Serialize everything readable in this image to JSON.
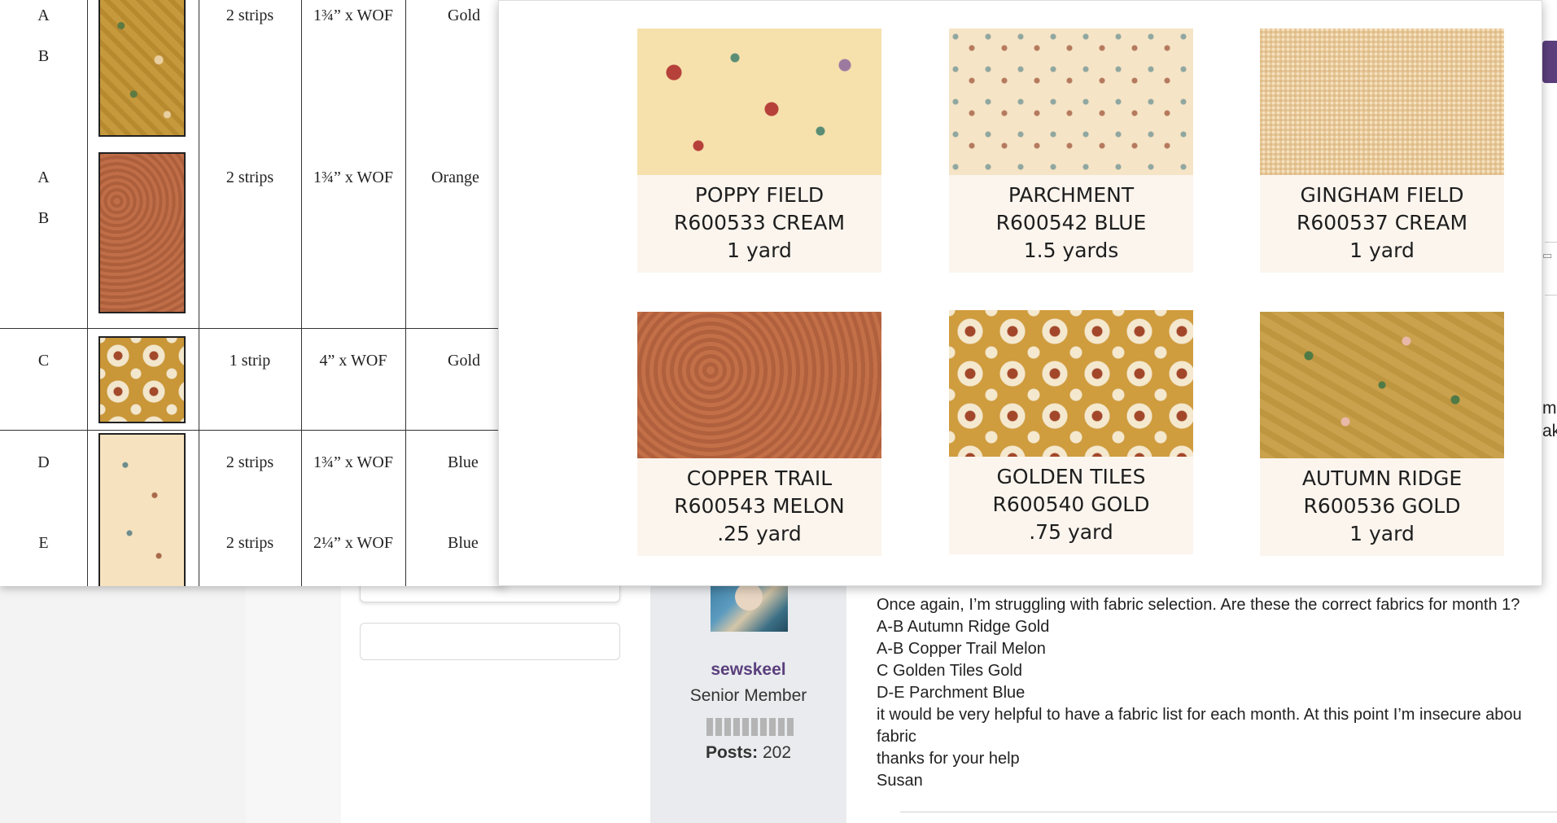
{
  "fabric_table": {
    "rows": [
      {
        "letters": [
          "A",
          "B"
        ],
        "swatch": "gold-floral",
        "qty": "2 strips",
        "size": "1¾” x WOF",
        "color": "Gold"
      },
      {
        "letters": [
          "A",
          "B"
        ],
        "swatch": "copper",
        "qty": "2 strips",
        "size": "1¾” x WOF",
        "color": "Orange"
      },
      {
        "letters": [
          "C"
        ],
        "swatch": "golden-tiles",
        "qty": "1 strip",
        "size": "4” x WOF",
        "color": "Gold"
      },
      {
        "letters": [
          "D",
          "E"
        ],
        "swatch": "parchment",
        "qty": [
          "2 strips",
          "2 strips"
        ],
        "size": [
          "1¾” x WOF",
          "2¼” x WOF"
        ],
        "color": [
          "Blue",
          "Blue"
        ]
      }
    ]
  },
  "fabric_list": [
    {
      "name": "POPPY FIELD",
      "sku": "R600533  CREAM",
      "amount": "1 yard"
    },
    {
      "name": "PARCHMENT",
      "sku": "R600542  BLUE",
      "amount": "1.5 yards"
    },
    {
      "name": "GINGHAM FIELD",
      "sku": "R600537  CREAM",
      "amount": "1 yard"
    },
    {
      "name": "COPPER TRAIL",
      "sku": "R600543  MELON",
      "amount": ".25 yard"
    },
    {
      "name": "GOLDEN TILES",
      "sku": "R600540  GOLD",
      "amount": ".75 yard"
    },
    {
      "name": "AUTUMN RIDGE",
      "sku": "R600536  GOLD",
      "amount": "1 yard"
    }
  ],
  "user": {
    "name": "sewskeel",
    "rank": "Senior Member",
    "posts_label": "Posts:",
    "posts_count": "202"
  },
  "post": {
    "lines": [
      "Once again, I’m struggling with fabric selection. Are these the correct fabrics for month 1?",
      "A-B Autumn Ridge Gold",
      "A-B Copper Trail Melon",
      "C Golden Tiles Gold",
      "D-E Parchment Blue",
      "it would be very helpful to have a fabric list for each month. At this point I’m insecure abou",
      "fabric",
      "thanks for your help",
      "Susan"
    ]
  },
  "edge_fragments": [
    "m",
    "ak"
  ],
  "colors": {
    "brand_purple": "#5b3f7d",
    "username": "#5b3f7d"
  }
}
